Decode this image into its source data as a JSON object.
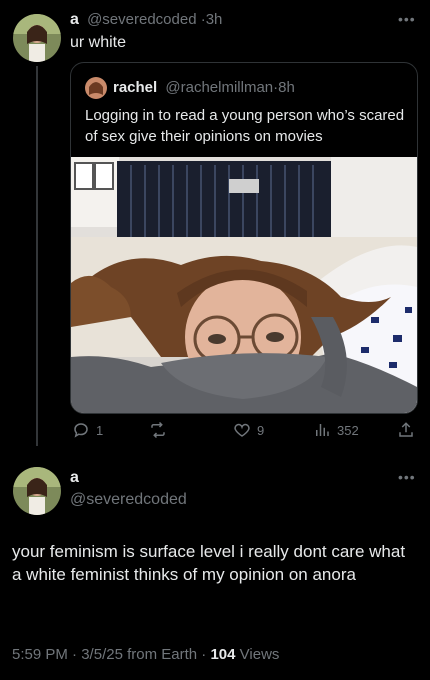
{
  "tweet": {
    "display_name": "a",
    "handle": "@severedcoded",
    "separator": "·",
    "time": "3h",
    "text": "ur white",
    "more_label": "•••"
  },
  "quoted": {
    "display_name": "rachel",
    "handle": "@rachelmillman",
    "separator": "·",
    "time": "8h",
    "text": "Logging in to read a young person who’s scared of sex give their opinions on movies"
  },
  "actions": {
    "reply_count": "1",
    "retweet_count": "",
    "like_count": "9",
    "view_count": "352"
  },
  "reply": {
    "display_name": "a",
    "handle": "@severedcoded",
    "more_label": "•••",
    "text": "your feminism is surface level i really dont care what a white feminist thinks of my opinion on anora",
    "time": "5:59 PM",
    "separator": "·",
    "date": "3/5/25 from Earth",
    "views_count": "104",
    "views_label": "Views"
  },
  "colors": {
    "background": "#000000",
    "text": "#e7e9ea",
    "muted": "#71767b",
    "border": "#2f3336"
  },
  "icons": {
    "reply": "reply-icon",
    "retweet": "retweet-icon",
    "like": "heart-icon",
    "views": "bar-chart-icon",
    "share": "share-icon",
    "more": "more-icon"
  }
}
